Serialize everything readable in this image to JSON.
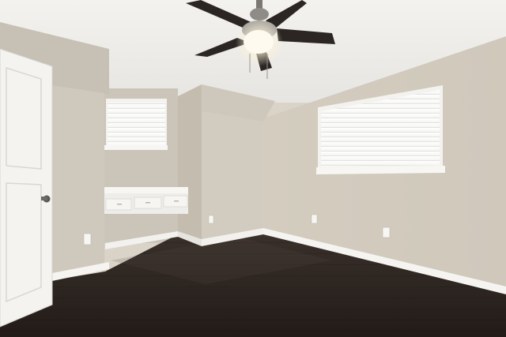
{
  "scene": {
    "subject": "empty-bedroom",
    "palette": {
      "ceiling": "#f1f0ed",
      "wall_light": "#d8d2c7",
      "wall_mid": "#cdc6ba",
      "wall_shadow": "#bdb5a8",
      "floor": "#2a221d",
      "floor_highlight": "#4a3f38",
      "trim": "#f7f6f3",
      "door": "#f4f3f0",
      "fan_blade": "#2b2623",
      "fan_light": "#fff6df",
      "window_glow": "#fbfbfa"
    }
  }
}
